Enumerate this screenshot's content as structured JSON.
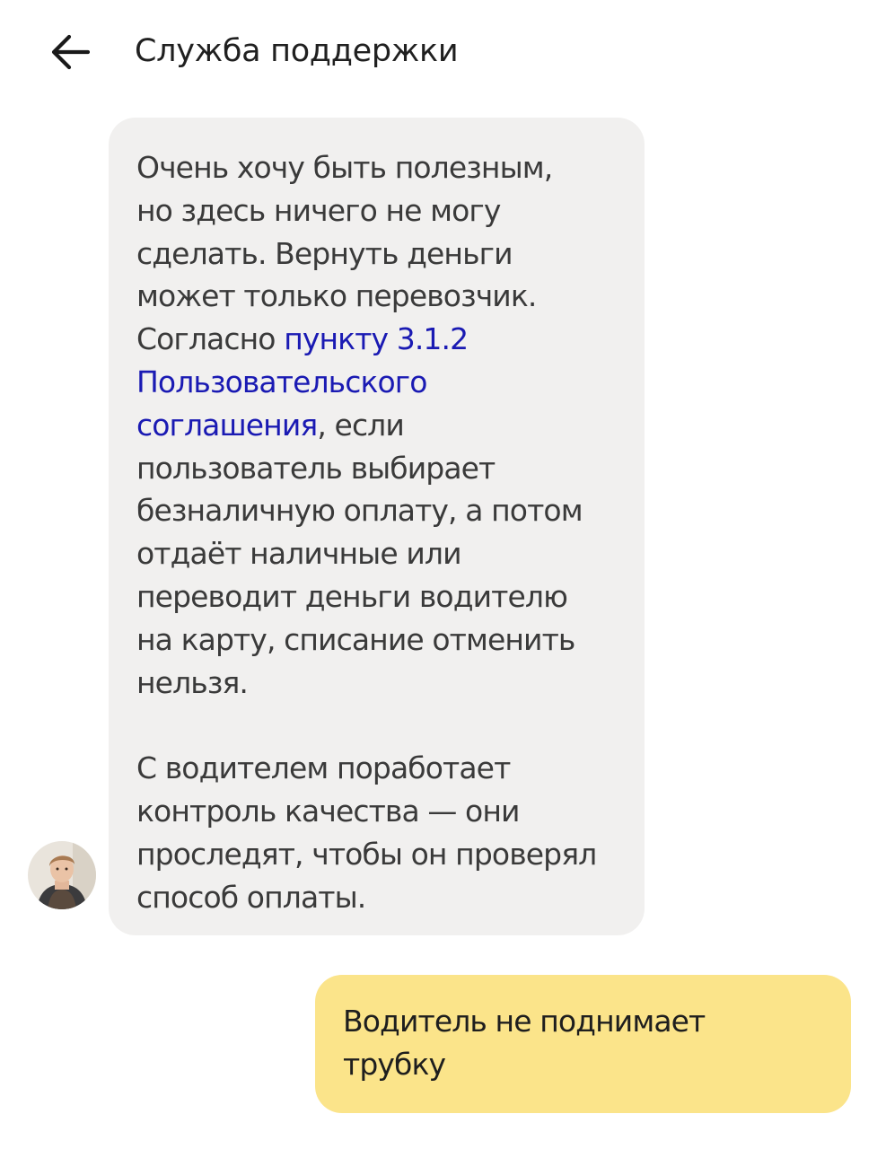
{
  "header": {
    "title": "Служба поддержки",
    "back_icon": "arrow-left-icon"
  },
  "support_message": {
    "lines": [
      "Очень хочу быть полезным,",
      "но здесь ничего не могу",
      "сделать. Вернуть деньги",
      "может только перевозчик."
    ],
    "link_prefix": "Согласно ",
    "link_text_1": "пункту 3.1.2",
    "link_text_2": "Пользовательского",
    "link_text_3": "соглашения",
    "after_link": ", если",
    "lines_after": [
      "пользователь выбирает",
      "безналичную оплату, а потом",
      "отдаёт наличные или",
      "переводит деньги водителю",
      "на карту, списание отменить",
      "нельзя."
    ],
    "paragraph_2": [
      "С водителем поработает",
      "контроль качества — они",
      "проследят, чтобы он проверял",
      "способ оплаты."
    ]
  },
  "user_message": {
    "lines": [
      "Водитель не поднимает",
      "трубку"
    ]
  },
  "colors": {
    "incoming_bubble": "#f1f0ef",
    "outgoing_bubble": "#fbe48a",
    "link": "#1a1ab3"
  }
}
